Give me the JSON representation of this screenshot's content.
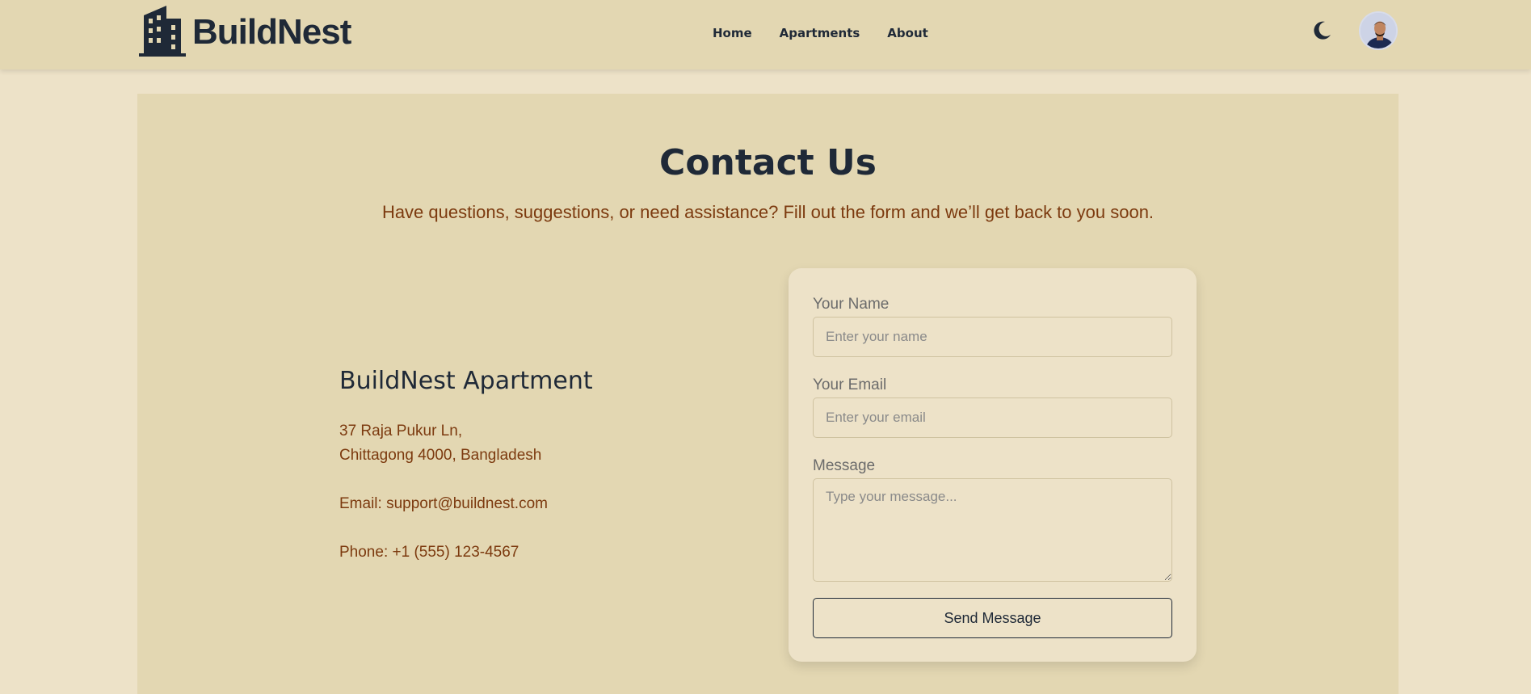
{
  "nav": {
    "brand": "BuildNest",
    "links": [
      {
        "label": "Home"
      },
      {
        "label": "Apartments"
      },
      {
        "label": "About"
      }
    ],
    "theme_icon": "moon-icon",
    "avatar_icon": "user-avatar"
  },
  "contact": {
    "title": "Contact Us",
    "subtitle": "Have questions, suggestions, or need assistance? Fill out the form and we’ll get back to you soon."
  },
  "info": {
    "name": "BuildNest Apartment",
    "address_line1": "37 Raja Pukur Ln,",
    "address_line2": "Chittagong 4000, Bangladesh",
    "email": "Email: support@buildnest.com",
    "phone": "Phone: +1 (555) 123-4567"
  },
  "form": {
    "name_label": "Your Name",
    "name_placeholder": "Enter your name",
    "email_label": "Your Email",
    "email_placeholder": "Enter your email",
    "message_label": "Message",
    "message_placeholder": "Type your message...",
    "submit_label": "Send Message"
  },
  "colors": {
    "page_bg": "#ede2c8",
    "panel_bg": "#e3d7b2",
    "heading": "#1f2937",
    "accent_text": "#7c3a0f"
  }
}
